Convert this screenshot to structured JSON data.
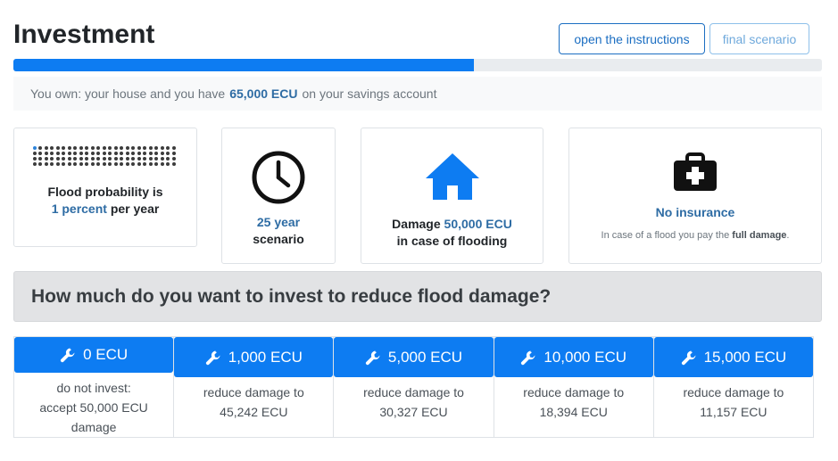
{
  "header": {
    "title": "Investment",
    "instructions_label": "open the instructions",
    "final_label": "final scenario"
  },
  "progress": {
    "fraction": 0.57
  },
  "savings": {
    "prefix": "You own: your house and you have",
    "amount": "65,000 ECU",
    "suffix": "on your savings account"
  },
  "cards": {
    "probability": {
      "line1": "Flood probability is",
      "value": "1 percent",
      "suffix": "per year",
      "highlighted_dots": 1,
      "total_dots": 100
    },
    "timeframe": {
      "value": "25 year",
      "label": "scenario",
      "icon": "clock-icon"
    },
    "damage": {
      "prefix": "Damage",
      "value": "50,000 ECU",
      "line2": "in case of flooding",
      "icon": "house-icon"
    },
    "insurance": {
      "title": "No insurance",
      "sub_prefix": "In case of a flood you pay the",
      "sub_bold": "full damage",
      "sub_suffix": ".",
      "icon": "briefcase-medical-icon"
    }
  },
  "question": "How much do you want to invest to reduce flood damage?",
  "options": [
    {
      "label": "0 ECU",
      "desc": "do not invest:\naccept 50,000 ECU\ndamage"
    },
    {
      "label": "1,000 ECU",
      "desc": "reduce damage to\n45,242 ECU"
    },
    {
      "label": "5,000 ECU",
      "desc": "reduce damage to\n30,327 ECU"
    },
    {
      "label": "10,000 ECU",
      "desc": "reduce damage to\n18,394 ECU"
    },
    {
      "label": "15,000 ECU",
      "desc": "reduce damage to\n11,157 ECU"
    }
  ],
  "colors": {
    "primary": "#0d7cf2",
    "highlight": "#2e6ca4"
  }
}
